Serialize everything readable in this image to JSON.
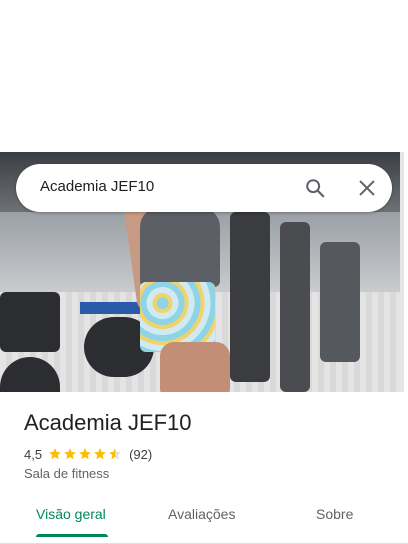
{
  "search": {
    "query": "Academia JEF10"
  },
  "place": {
    "name": "Academia JEF10",
    "rating": "4,5",
    "rating_fraction": 0.9,
    "review_count": "(92)",
    "category": "Sala de fitness"
  },
  "tabs": [
    {
      "label": "Visão geral",
      "active": true
    },
    {
      "label": "Avaliações",
      "active": false
    },
    {
      "label": "Sobre",
      "active": false
    }
  ],
  "icons": {
    "search": "search-icon",
    "close": "close-icon",
    "star": "star-icon"
  },
  "colors": {
    "accent": "#01875f",
    "star": "#fbbc04",
    "star_empty": "#dadce0"
  }
}
